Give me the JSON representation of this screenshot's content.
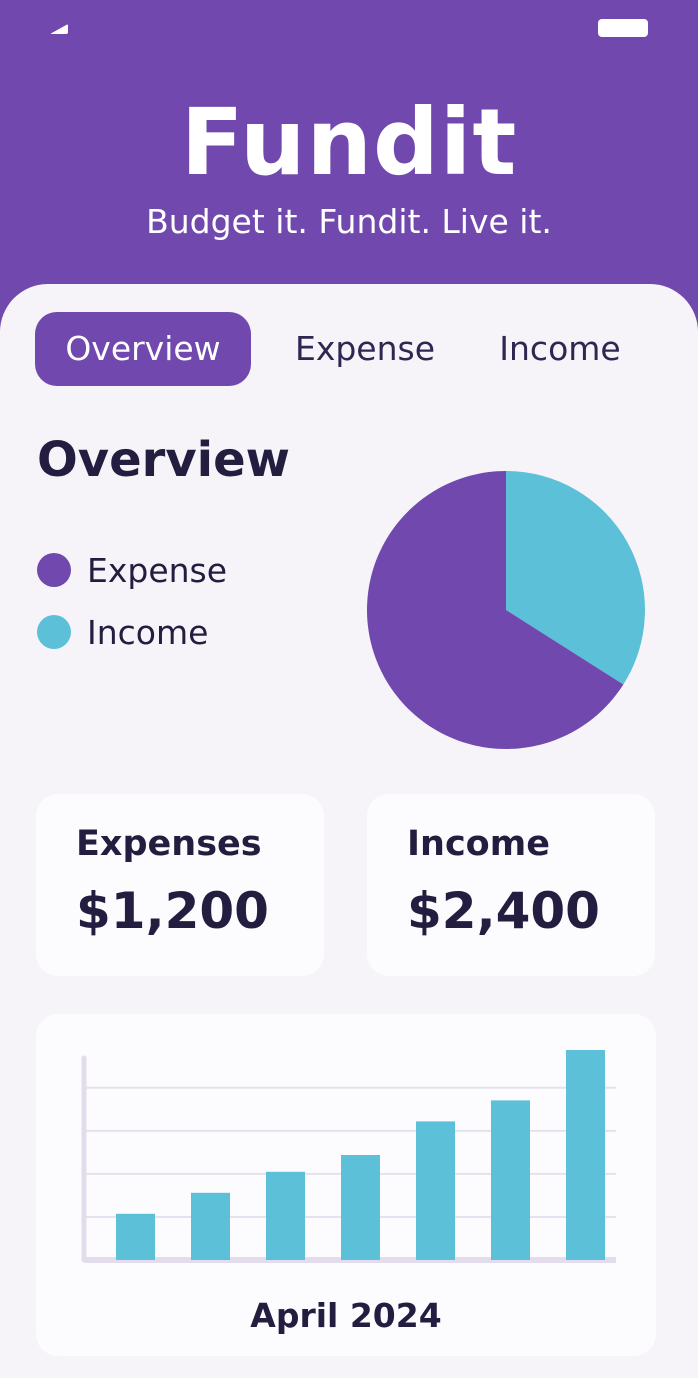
{
  "app": {
    "title": "Fundit",
    "tagline": "Budget it. Fundit. Live it."
  },
  "status_bar": {
    "icons": [
      "signal-icon",
      "battery-icon"
    ]
  },
  "tabs": [
    {
      "label": "Overview",
      "active": true
    },
    {
      "label": "Expense",
      "active": false
    },
    {
      "label": "Income",
      "active": false
    }
  ],
  "overview": {
    "title": "Overview",
    "legend": [
      {
        "label": "Expense",
        "color": "#7048ae"
      },
      {
        "label": "Income",
        "color": "#5bc0d8"
      }
    ]
  },
  "cards": {
    "expenses": {
      "label": "Expenses",
      "value": "$1,200"
    },
    "income": {
      "label": "Income",
      "value": "$2,400"
    }
  },
  "colors": {
    "primary": "#7048ae",
    "accent": "#5bc0d8",
    "text": "#231d40"
  },
  "chart_data": [
    {
      "type": "pie",
      "labels": [
        "Expense",
        "Income"
      ],
      "values": [
        66,
        34
      ],
      "colors": [
        "#7048ae",
        "#5bc0d8"
      ]
    },
    {
      "type": "bar",
      "title": "April 2024",
      "categories": [
        "",
        "",
        "",
        "",
        "",
        "",
        ""
      ],
      "values": [
        22,
        32,
        42,
        50,
        66,
        76,
        100
      ],
      "ylim": [
        0,
        100
      ],
      "grid": true,
      "color": "#5bc0d8"
    }
  ]
}
